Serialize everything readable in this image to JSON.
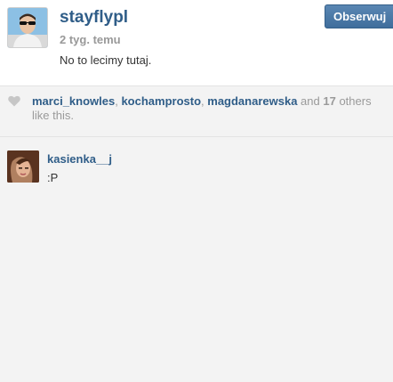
{
  "post": {
    "author": {
      "username": "stayflypl",
      "avatar": "profile-photo-man-sunglasses"
    },
    "time_ago": "2 tyg. temu",
    "caption": "No to lecimy tutaj.",
    "follow_button_label": "Obserwuj"
  },
  "likes": {
    "icon": "heart-icon",
    "likers": [
      "marci_knowles",
      "kochamprosto",
      "magdanarewska"
    ],
    "separator": ", ",
    "and_text": " and ",
    "others_count": "17",
    "suffix": " others like this."
  },
  "comments": [
    {
      "username": "kasienka__j",
      "text": ":P",
      "avatar": "profile-photo-woman"
    }
  ],
  "colors": {
    "link": "#2f5d88",
    "muted": "#9a9a9a",
    "follow_button": "#4a7aa8",
    "background": "#f3f3f3"
  }
}
